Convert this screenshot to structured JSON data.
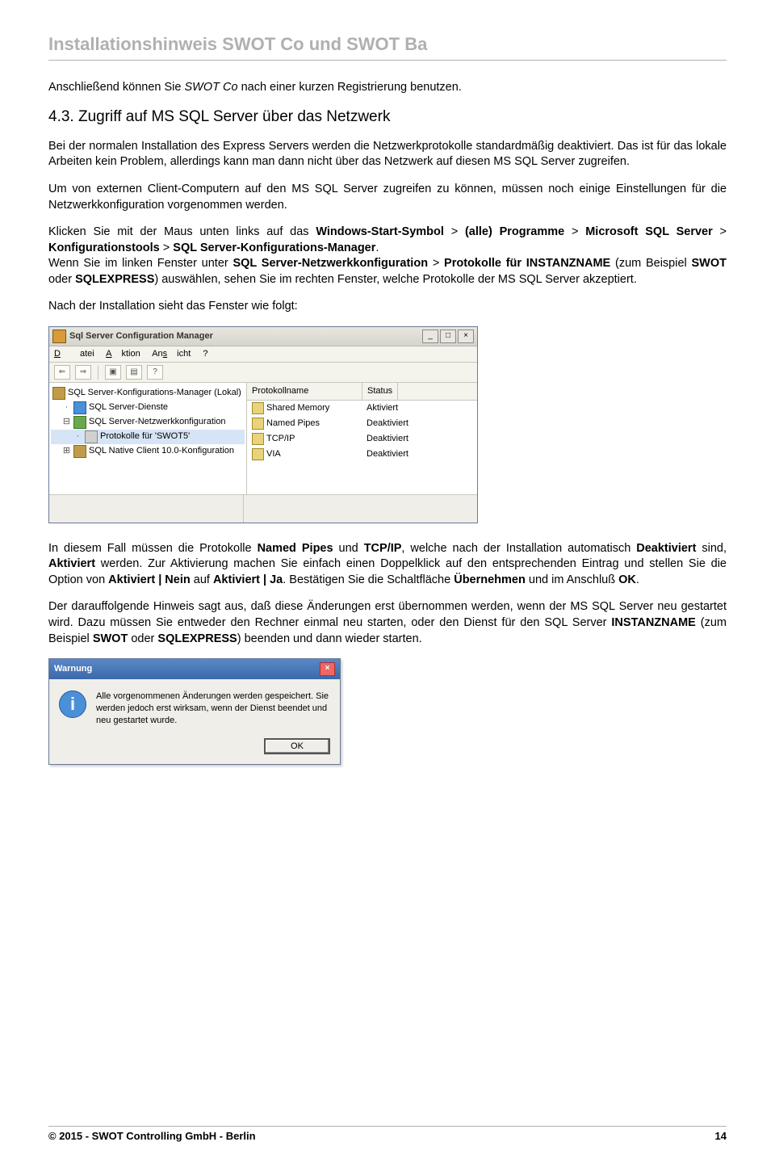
{
  "header": "Installationshinweis SWOT Co und SWOT Ba",
  "intro_pre": "Anschließend können Sie ",
  "intro_em": "SWOT Co",
  "intro_post": " nach einer kurzen Registrierung benutzen.",
  "section_heading": "4.3. Zugriff auf MS SQL Server über das Netzwerk",
  "p1": "Bei der normalen Installation des Express Servers werden die Netzwerkprotokolle standardmäßig deaktiviert. Das ist für das lokale Arbeiten kein Problem, allerdings kann man dann nicht über das Netzwerk auf diesen MS SQL Server zugreifen.",
  "p2": "Um von externen Client-Computern auf den MS SQL Server zugreifen zu können, müssen noch einige Einstellungen für die Netzwerkkonfiguration vorgenommen werden.",
  "p3a": "Klicken Sie mit der Maus unten links auf das ",
  "p3b": "Windows-Start-Symbol",
  "p3c": " > ",
  "p3d": "(alle) Programme",
  "p3e": " > ",
  "p3f": "Microsoft SQL Server",
  "p3g": " > ",
  "p3h": "Konfigurationstools",
  "p3i": " > ",
  "p3j": "SQL Server-Konfigurations-Manager",
  "p3k": ".",
  "p4a": "Wenn Sie im linken Fenster unter ",
  "p4b": "SQL Server-Netzwerkkonfiguration",
  "p4c": " > ",
  "p4d": "Protokolle für INSTANZNAME",
  "p4e": " (zum Beispiel ",
  "p4f": "SWOT",
  "p4g": " oder ",
  "p4h": "SQLEXPRESS",
  "p4i": ") auswählen, sehen Sie im rechten Fenster, welche Protokolle der MS SQL Server akzeptiert.",
  "p5": "Nach der Installation sieht das Fenster wie folgt:",
  "cfgmgr": {
    "title": "Sql Server Configuration Manager",
    "menu": {
      "m1": "Datei",
      "m2": "Aktion",
      "m3": "Ansicht",
      "m4": "?"
    },
    "tree": {
      "root": "SQL Server-Konfigurations-Manager (Lokal)",
      "n1": "SQL Server-Dienste",
      "n2": "SQL Server-Netzwerkkonfiguration",
      "n2a": "Protokolle für 'SWOT5'",
      "n3": "SQL Native Client 10.0-Konfiguration"
    },
    "cols": {
      "c1": "Protokollname",
      "c2": "Status"
    },
    "rows": [
      {
        "name": "Shared Memory",
        "status": "Aktiviert"
      },
      {
        "name": "Named Pipes",
        "status": "Deaktiviert"
      },
      {
        "name": "TCP/IP",
        "status": "Deaktiviert"
      },
      {
        "name": "VIA",
        "status": "Deaktiviert"
      }
    ]
  },
  "p6a": "In diesem Fall müssen die Protokolle ",
  "p6b": "Named Pipes",
  "p6c": " und ",
  "p6d": "TCP/IP",
  "p6e": ", welche nach der Installation automatisch ",
  "p6f": "Deaktiviert",
  "p6g": " sind, ",
  "p6h": "Aktiviert",
  "p6i": " werden. Zur Aktivierung machen Sie einfach einen Doppelklick auf den entsprechenden Eintrag und stellen Sie die Option von ",
  "p6j": "Aktiviert | Nein",
  "p6k": " auf ",
  "p6l": "Aktiviert | Ja",
  "p6m": ". Bestätigen Sie die Schaltfläche ",
  "p6n": "Übernehmen",
  "p6o": " und im Anschluß ",
  "p6p": "OK",
  "p6q": ".",
  "p7a": "Der darauffolgende Hinweis sagt aus, daß diese Änderungen erst übernommen werden, wenn der MS SQL Server neu gestartet wird. Dazu müssen Sie entweder den Rechner einmal neu starten, oder den Dienst für den SQL Server ",
  "p7b": "INSTANZNAME",
  "p7c": " (zum Beispiel ",
  "p7d": "SWOT",
  "p7e": " oder ",
  "p7f": "SQLEXPRESS",
  "p7g": ") beenden und dann wieder starten.",
  "warn": {
    "title": "Warnung",
    "msg": "Alle vorgenommenen Änderungen werden gespeichert. Sie werden jedoch erst wirksam, wenn der Dienst beendet und neu gestartet wurde.",
    "ok": "OK"
  },
  "footer_left": "© 2015 - SWOT Controlling GmbH - Berlin",
  "footer_right": "14"
}
